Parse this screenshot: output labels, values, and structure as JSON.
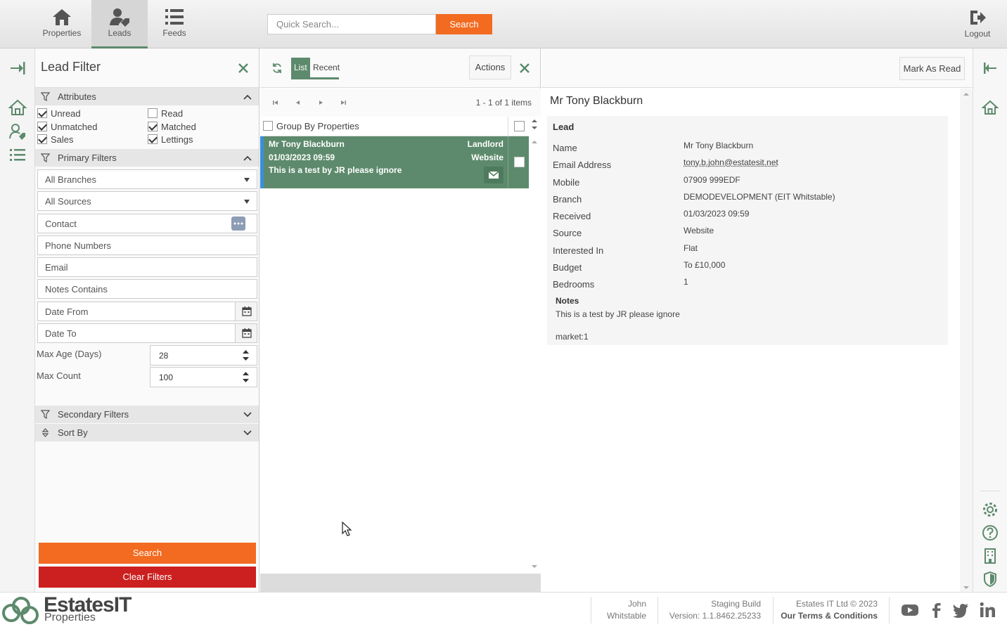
{
  "topnav": {
    "items": [
      {
        "label": "Properties",
        "icon": "home-icon"
      },
      {
        "label": "Leads",
        "icon": "user-tag-icon"
      },
      {
        "label": "Feeds",
        "icon": "list-icon"
      }
    ],
    "search_placeholder": "Quick Search...",
    "search_button": "Search",
    "logout": "Logout"
  },
  "filter": {
    "title": "Lead Filter",
    "attributes_label": "Attributes",
    "attributes": [
      {
        "label": "Unread",
        "checked": true
      },
      {
        "label": "Read",
        "checked": false
      },
      {
        "label": "Unmatched",
        "checked": true
      },
      {
        "label": "Matched",
        "checked": true
      },
      {
        "label": "Sales",
        "checked": true
      },
      {
        "label": "Lettings",
        "checked": true
      }
    ],
    "primary_label": "Primary Filters",
    "branches": "All Branches",
    "sources": "All Sources",
    "contact_placeholder": "Contact",
    "phone_placeholder": "Phone Numbers",
    "email_placeholder": "Email",
    "notes_placeholder": "Notes Contains",
    "date_from_placeholder": "Date From",
    "date_to_placeholder": "Date To",
    "max_age_label": "Max Age (Days)",
    "max_age_value": "28",
    "max_count_label": "Max Count",
    "max_count_value": "100",
    "secondary_label": "Secondary Filters",
    "sort_label": "Sort By",
    "search_button": "Search",
    "clear_button": "Clear Filters"
  },
  "list": {
    "tabs": [
      "List",
      "Recent"
    ],
    "actions": "Actions",
    "count": "1 - 1 of 1 items",
    "group_by": "Group By Properties",
    "rows": [
      {
        "name": "Mr Tony Blackburn",
        "date": "01/03/2023 09:59",
        "note": "This is a test by JR please ignore",
        "type": "Landlord",
        "source": "Website"
      }
    ]
  },
  "detail": {
    "mark_read": "Mark As Read",
    "name": "Mr Tony Blackburn",
    "section": "Lead",
    "fields": [
      {
        "label": "Name",
        "value": "Mr Tony Blackburn"
      },
      {
        "label": "Email Address",
        "value": "tony.b.john@estatesit.net"
      },
      {
        "label": "Mobile",
        "value": "07909 999EDF"
      },
      {
        "label": "Branch",
        "value": "DEMODEVELOPMENT (EIT Whitstable)"
      },
      {
        "label": "Received",
        "value": "01/03/2023 09:59"
      },
      {
        "label": "Source",
        "value": "Website"
      },
      {
        "label": "Interested In",
        "value": "Flat"
      },
      {
        "label": "Budget",
        "value": "To £10,000"
      },
      {
        "label": "Bedrooms",
        "value": "1"
      }
    ],
    "notes_label": "Notes",
    "notes_text": "This is a test by JR please ignore",
    "market": "market:1"
  },
  "footer": {
    "brand": "EstatesIT",
    "brand_sub": "Properties",
    "user_first": "John",
    "user_branch": "Whitstable",
    "build_label": "Staging Build",
    "version": "Version: 1.1.8462.25233",
    "copyright": "Estates IT Ltd © 2023",
    "terms": "Our Terms & Conditions"
  },
  "colors": {
    "accent": "#f26b21",
    "green": "#5d8a6c",
    "danger": "#cc1f1f",
    "blue": "#3a8fd8"
  }
}
